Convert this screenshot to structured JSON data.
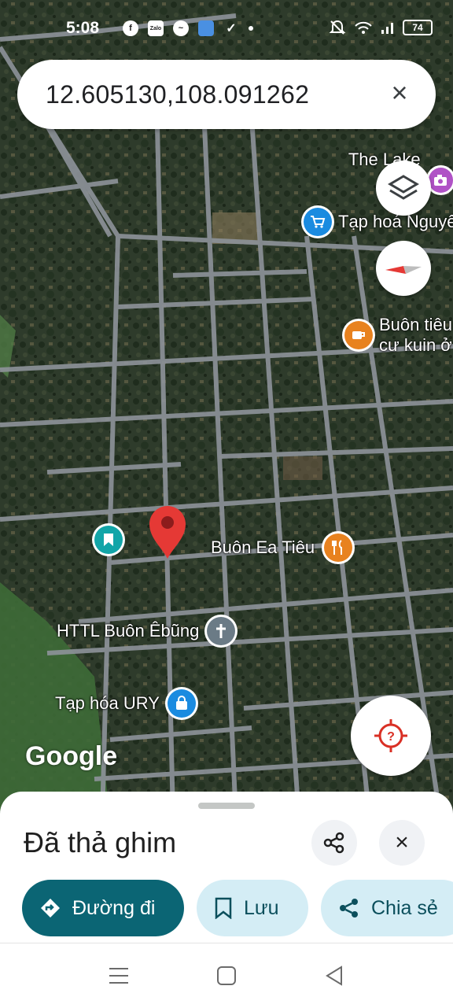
{
  "status_bar": {
    "time": "5:08",
    "app_icons": [
      "facebook-icon",
      "zalo-icon",
      "messenger-icon",
      "app-icon",
      "bird-icon",
      "dot-icon"
    ],
    "zalo_label": "Zalo",
    "battery_level": "74",
    "system_icons": [
      "mute-icon",
      "wifi-icon",
      "signal-icon",
      "battery-icon"
    ]
  },
  "search": {
    "value": "12.605130,108.091262"
  },
  "map": {
    "type": "satellite",
    "attribution": "Google",
    "pois": [
      {
        "label": "The Lake Farm\n- Đă",
        "icon": "camera-icon",
        "color": "#b052c6"
      },
      {
        "label": "Tạp hoá Nguyê",
        "icon": "shopping-cart-icon",
        "color": "#1a8be0"
      },
      {
        "label": "Buôn tiêu\ncư kuin ở",
        "icon": "coffee-icon",
        "color": "#e8821f"
      },
      {
        "label": "Buôn Ea Tiêu",
        "icon": "restaurant-icon",
        "color": "#e8821f"
      },
      {
        "label": "HTTL Buôn Êbũng",
        "icon": "cross-icon",
        "color": "#6b7b86"
      },
      {
        "label": "Tạp hóa URY",
        "icon": "shopping-bag-icon",
        "color": "#1a8be0"
      },
      {
        "label": "",
        "icon": "bookmark-icon",
        "color": "#12a5a8"
      }
    ],
    "dropped_pin_color": "#e53935"
  },
  "sheet": {
    "title": "Đã thả ghim",
    "actions": {
      "directions": "Đường đi",
      "save": "Lưu",
      "share": "Chia sẻ"
    }
  },
  "colors": {
    "primary": "#0b6574",
    "chip_light": "#d4edf5"
  }
}
